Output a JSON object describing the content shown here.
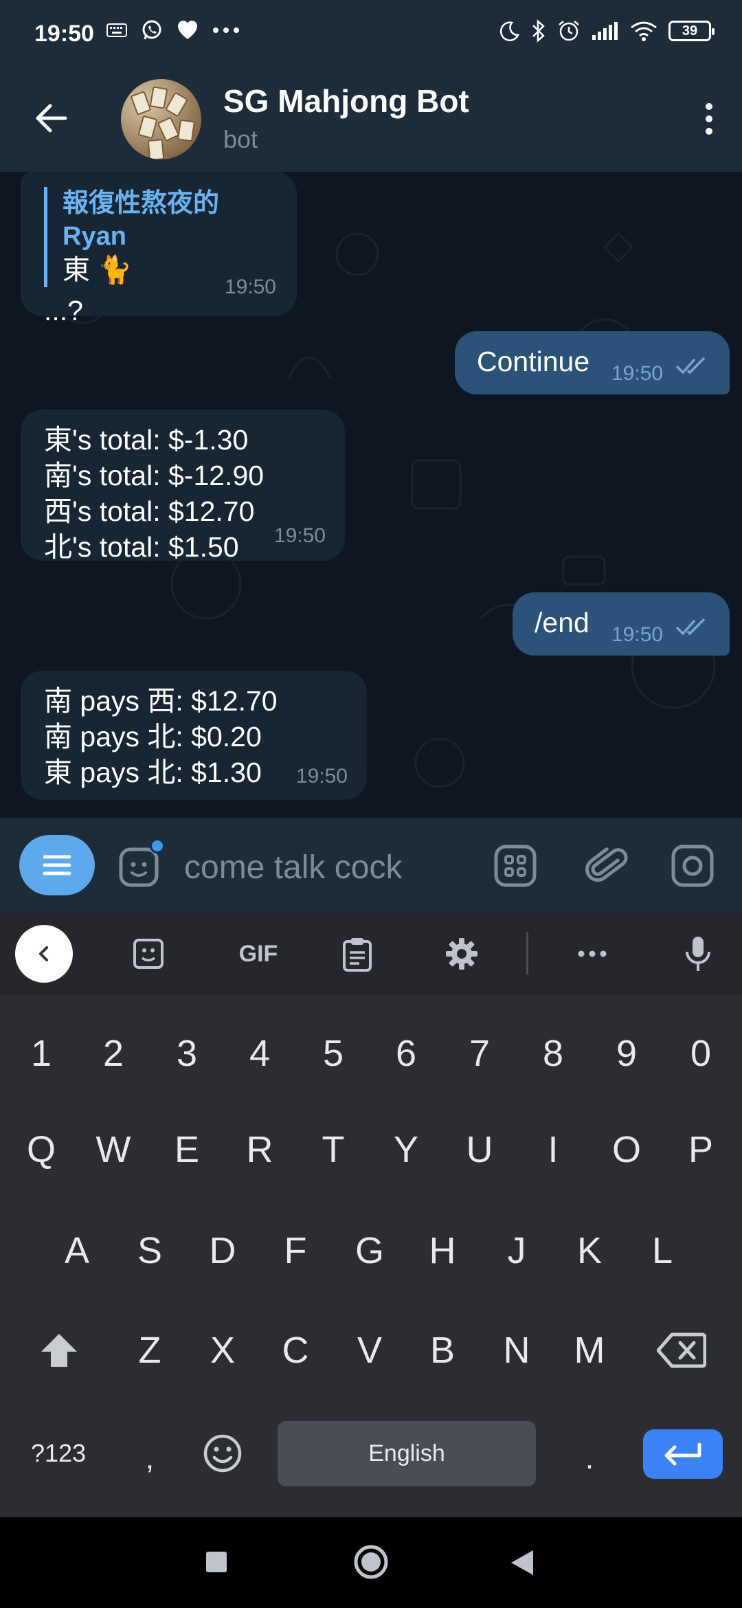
{
  "status_bar": {
    "time": "19:50",
    "battery": "39",
    "icons_left": [
      "keyboard-icon",
      "whatsapp-icon",
      "heart-icon",
      "more-dots-icon"
    ],
    "icons_right": [
      "moon-icon",
      "bluetooth-icon",
      "alarm-icon",
      "signal-icon",
      "wifi-icon",
      "battery-icon"
    ]
  },
  "header": {
    "title": "SG Mahjong Bot",
    "subtitle": "bot"
  },
  "messages": [
    {
      "direction": "in",
      "reply_name": "報復性熬夜的Ryan",
      "reply_text": "東 🐈",
      "text": "...?",
      "time": "19:50"
    },
    {
      "direction": "out",
      "text": "Continue",
      "time": "19:50"
    },
    {
      "direction": "in",
      "lines": [
        "東's total: $-1.30",
        "南's total: $-12.90",
        "西's total: $12.70",
        "北's total: $1.50"
      ],
      "time": "19:50"
    },
    {
      "direction": "out",
      "text": "/end",
      "time": "19:50"
    },
    {
      "direction": "in",
      "lines": [
        "南 pays 西: $12.70",
        "南 pays 北: $0.20",
        "東 pays 北: $1.30"
      ],
      "time": "19:50"
    }
  ],
  "input": {
    "placeholder": "come talk cock"
  },
  "keyboard": {
    "toolbar": {
      "gif_label": "GIF"
    },
    "number_row": [
      "1",
      "2",
      "3",
      "4",
      "5",
      "6",
      "7",
      "8",
      "9",
      "0"
    ],
    "row1": [
      "Q",
      "W",
      "E",
      "R",
      "T",
      "Y",
      "U",
      "I",
      "O",
      "P"
    ],
    "row2": [
      "A",
      "S",
      "D",
      "F",
      "G",
      "H",
      "J",
      "K",
      "L"
    ],
    "row3": [
      "Z",
      "X",
      "C",
      "V",
      "B",
      "N",
      "M"
    ],
    "symbols_label": "?123",
    "comma": ",",
    "period": ".",
    "space_label": "English"
  },
  "colors": {
    "header_bg": "#1e2c3a",
    "chat_bg": "#0e1621",
    "incoming_bubble": "#182533",
    "outgoing_bubble": "#2b5278",
    "accent": "#6ab3f3",
    "keyboard_bg": "#2b2d33",
    "enter_key": "#3b82f6"
  }
}
